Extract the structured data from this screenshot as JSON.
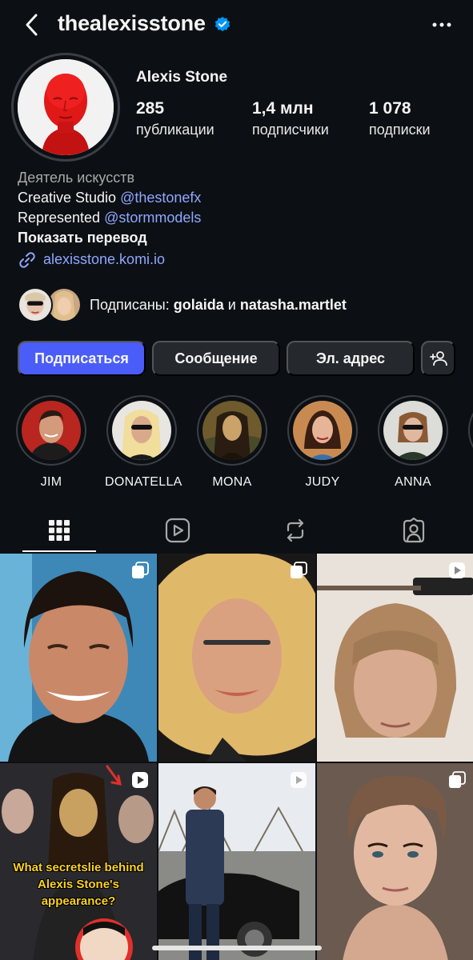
{
  "header": {
    "username": "thealexisstone"
  },
  "profile": {
    "display_name": "Alexis Stone",
    "stats": [
      {
        "value": "285",
        "label": "публикации"
      },
      {
        "value": "1,4 млн",
        "label": "подписчики"
      },
      {
        "value": "1 078",
        "label": "подписки"
      }
    ]
  },
  "bio": {
    "category": "Деятель искусств",
    "line1_text": "Creative Studio ",
    "line1_mention": "@thestonefx",
    "line2_text": "Represented ",
    "line2_mention": "@stormmodels",
    "translate": "Показать перевод",
    "link": "alexisstone.komi.io"
  },
  "followed_by": {
    "prefix": "Подписаны: ",
    "user1": "golaida",
    "conj": " и ",
    "user2": "natasha.martlet"
  },
  "actions": {
    "follow": "Подписаться",
    "message": "Сообщение",
    "email": "Эл. адрес"
  },
  "highlights": [
    {
      "label": "JIM"
    },
    {
      "label": "DONATELLA"
    },
    {
      "label": "MONA"
    },
    {
      "label": "JUDY"
    },
    {
      "label": "ANNA"
    }
  ],
  "posts": {
    "overlay_text_1": "What secretslie behind",
    "overlay_text_2": "Alexis Stone's",
    "overlay_text_3": "appearance?"
  },
  "colors": {
    "background": "#0c1014",
    "accent": "#4a5df9",
    "link": "#8fa7ff",
    "verified": "#0095f6"
  }
}
